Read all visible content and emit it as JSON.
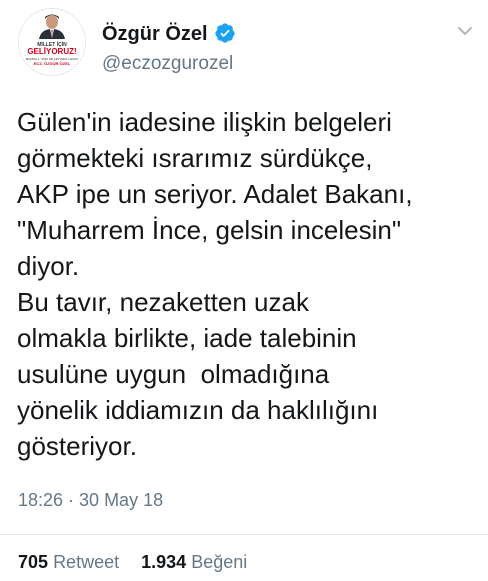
{
  "user": {
    "name": "Özgür Özel",
    "handle": "@eczozgurozel",
    "avatar_text": {
      "line1": "MİLLET İÇİN",
      "line2": "GELİYORUZ!",
      "line3": "MANİSA 1. SIRA MİLLETVEKİLİ ADAYI",
      "line4": "ECZ. ÖZGÜR ÖZEL"
    }
  },
  "tweet": {
    "lines": [
      "Gülen'in iadesine ilişkin belgeleri",
      "görmekteki ısrarımız sürdükçe,",
      "AKP ipe un seriyor. Adalet Bakanı,",
      "\"Muharrem İnce, gelsin incelesin\"",
      "diyor.",
      "Bu tavır, nezaketten uzak",
      "olmakla birlikte, iade talebinin",
      "usulüne uygun  olmadığına",
      "yönelik iddiamızın da haklılığını",
      "gösteriyor."
    ],
    "timestamp": "18:26 · 30 May 18"
  },
  "stats": {
    "retweets_count": "705",
    "retweets_label": "Retweet",
    "likes_count": "1.934",
    "likes_label": "Beğeni"
  },
  "icons": {
    "verified": "verified-badge-icon",
    "menu": "chevron-down-icon"
  },
  "colors": {
    "verified_blue": "#1da1f2",
    "secondary_text": "#657786",
    "primary_text": "#14171a",
    "avatar_red": "#d0021b"
  }
}
